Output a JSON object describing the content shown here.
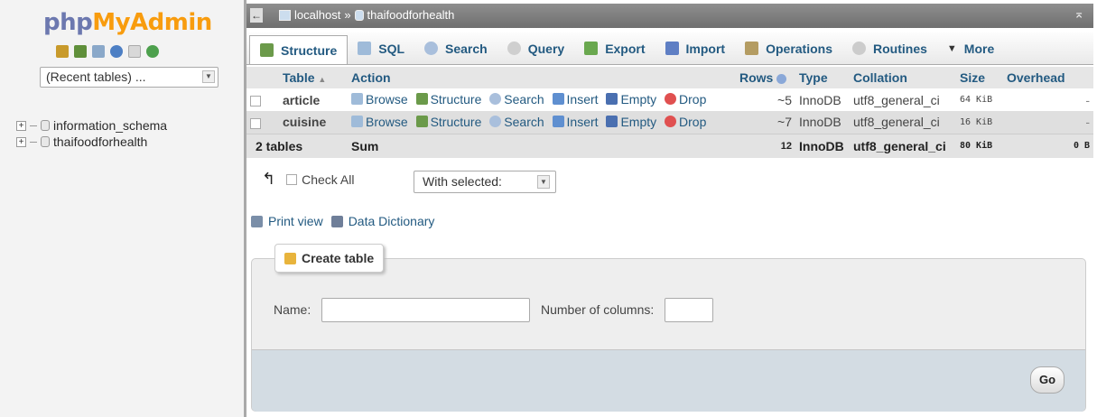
{
  "nav": {
    "logo_part1": "php",
    "logo_part2": "MyAdmin",
    "quick_icons": [
      "home-icon",
      "database-icon",
      "sql-icon",
      "help-icon",
      "docs-icon",
      "reload-icon"
    ],
    "recent_tables": "(Recent tables) ...",
    "databases": [
      "information_schema",
      "thaifoodforhealth"
    ]
  },
  "breadcrumb": {
    "server": "localhost",
    "separator": "»",
    "database": "thaifoodforhealth"
  },
  "tabs": [
    {
      "label": "Structure",
      "icon": "structure-icon",
      "color": "#4a8a3a"
    },
    {
      "label": "SQL",
      "icon": "sql-icon",
      "color": "#7fa2c9"
    },
    {
      "label": "Search",
      "icon": "search-icon",
      "color": "#9ab1d1"
    },
    {
      "label": "Query",
      "icon": "query-icon",
      "color": "#bbbbbb"
    },
    {
      "label": "Export",
      "icon": "export-icon",
      "color": "#5c9e46"
    },
    {
      "label": "Import",
      "icon": "import-icon",
      "color": "#5471b8"
    },
    {
      "label": "Operations",
      "icon": "wrench-icon",
      "color": "#9b8a5a"
    },
    {
      "label": "Routines",
      "icon": "routines-icon",
      "color": "#999999"
    },
    {
      "label": "More",
      "icon": "chevron-down-icon",
      "color": "#333333"
    }
  ],
  "table": {
    "headers": {
      "table": "Table",
      "action": "Action",
      "rows": "Rows",
      "type": "Type",
      "collation": "Collation",
      "size": "Size",
      "overhead": "Overhead"
    },
    "actions": [
      "Browse",
      "Structure",
      "Search",
      "Insert",
      "Empty",
      "Drop"
    ],
    "rows": [
      {
        "name": "article",
        "rows": "~5",
        "type": "InnoDB",
        "collation": "utf8_general_ci",
        "size": "64 KiB",
        "overhead": "-"
      },
      {
        "name": "cuisine",
        "rows": "~7",
        "type": "InnoDB",
        "collation": "utf8_general_ci",
        "size": "16 KiB",
        "overhead": "-"
      }
    ],
    "summary": {
      "count": "2 tables",
      "label": "Sum",
      "rows": "12",
      "type": "InnoDB",
      "collation": "utf8_general_ci",
      "size": "80 KiB",
      "overhead": "0 B"
    }
  },
  "bulk": {
    "check_all": "Check All",
    "with_selected": "With selected:"
  },
  "links": {
    "print_view": "Print view",
    "data_dictionary": "Data Dictionary"
  },
  "create": {
    "legend": "Create table",
    "name_label": "Name:",
    "columns_label": "Number of columns:",
    "go": "Go"
  }
}
